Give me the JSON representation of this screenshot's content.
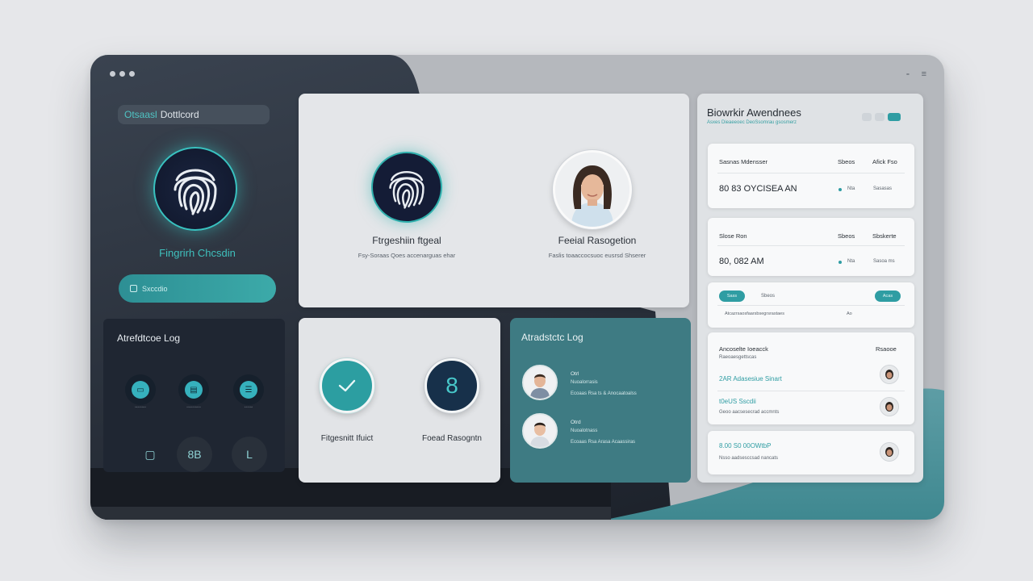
{
  "window": {
    "controls": [
      "•",
      "•",
      "•"
    ],
    "topright": [
      "⁃",
      "≡"
    ]
  },
  "sidebar": {
    "title_accent": "Otsaasl",
    "title_rest": "Dottlcord",
    "fingerprint_label": "Fingrirh Chcsdin",
    "input_placeholder": "Sxccdio",
    "log_title": "Atrefdtcoe Log",
    "log_icon_captions": [
      "◦◦◦◦◦◦◦◦",
      "◦◦◦◦◦◦◦◦◦◦",
      "◦◦◦◦◦◦"
    ],
    "bottom_icons": [
      "▢",
      "8B",
      "L"
    ]
  },
  "biometric_card": {
    "fingerprint_label": "Ftrgeshiin ftgeal",
    "fingerprint_sub": "Fsy-Soraas Qoes accenarguas ehar",
    "facial_label": "Feeial Rasogetion",
    "facial_sub": "Faslis toaaccocsuoc eusrsd Shserer"
  },
  "check_card": {
    "left_label": "Fitgesnitt Ifuict",
    "right_label": "Foead Rasogntn",
    "right_symbol": "8"
  },
  "teal_log": {
    "title": "Atradstctc Log",
    "entries": [
      {
        "name": "Otrl",
        "sub1": "Nuoalorrasis",
        "sub2": "Ecoaas   Rsa ts & Anocaatoalss"
      },
      {
        "name": "Otrd",
        "sub1": "Nuoalotnass",
        "sub2": "Ecoaas   Rsa  Arasa  Acaassiras"
      }
    ]
  },
  "panel": {
    "title": "Biowrkir Awendnees",
    "subtitle": "Asxes Dieaeeoec DeoSsomrau gsosmerz",
    "rows": [
      {
        "h1": "Sasnas Mdensser",
        "h2": "Sbeos",
        "h3": "Afick Fso",
        "big": "80 83 OYCISEA AN",
        "c2": "Nta",
        "c3": "Sasasas"
      },
      {
        "h1": "Slose Ron",
        "h2": "Sbeos",
        "h3": "Sbskerte",
        "big": "80, 082 AM",
        "c2": "Nta",
        "c3": "Sasoa ms"
      }
    ],
    "filter": {
      "chip1": "Sass",
      "chip2": "Sbeos",
      "chip3": "Acas",
      "text": "Atcazrsaosfaarsbsegrsrastaes",
      "mini": "Ao"
    },
    "activity": {
      "h1": "Ancoselte Ioeacck",
      "h1sub": "Raeoaesgettscas",
      "h2": "Rsaooe",
      "items": [
        {
          "accent": "2AR Adasesiue Sinart",
          "sub": ""
        },
        {
          "accent": "t0eUS Sscdii",
          "sub": "Geoo aacsesecrad accmnts"
        }
      ]
    },
    "last": {
      "accent": "8.00 S0 00OWtbP",
      "sub": "Nsso aadsesccsad nancats"
    }
  },
  "colors": {
    "accent": "#2f9da3",
    "dark": "#1f2632",
    "panel": "#dfe2e5"
  }
}
